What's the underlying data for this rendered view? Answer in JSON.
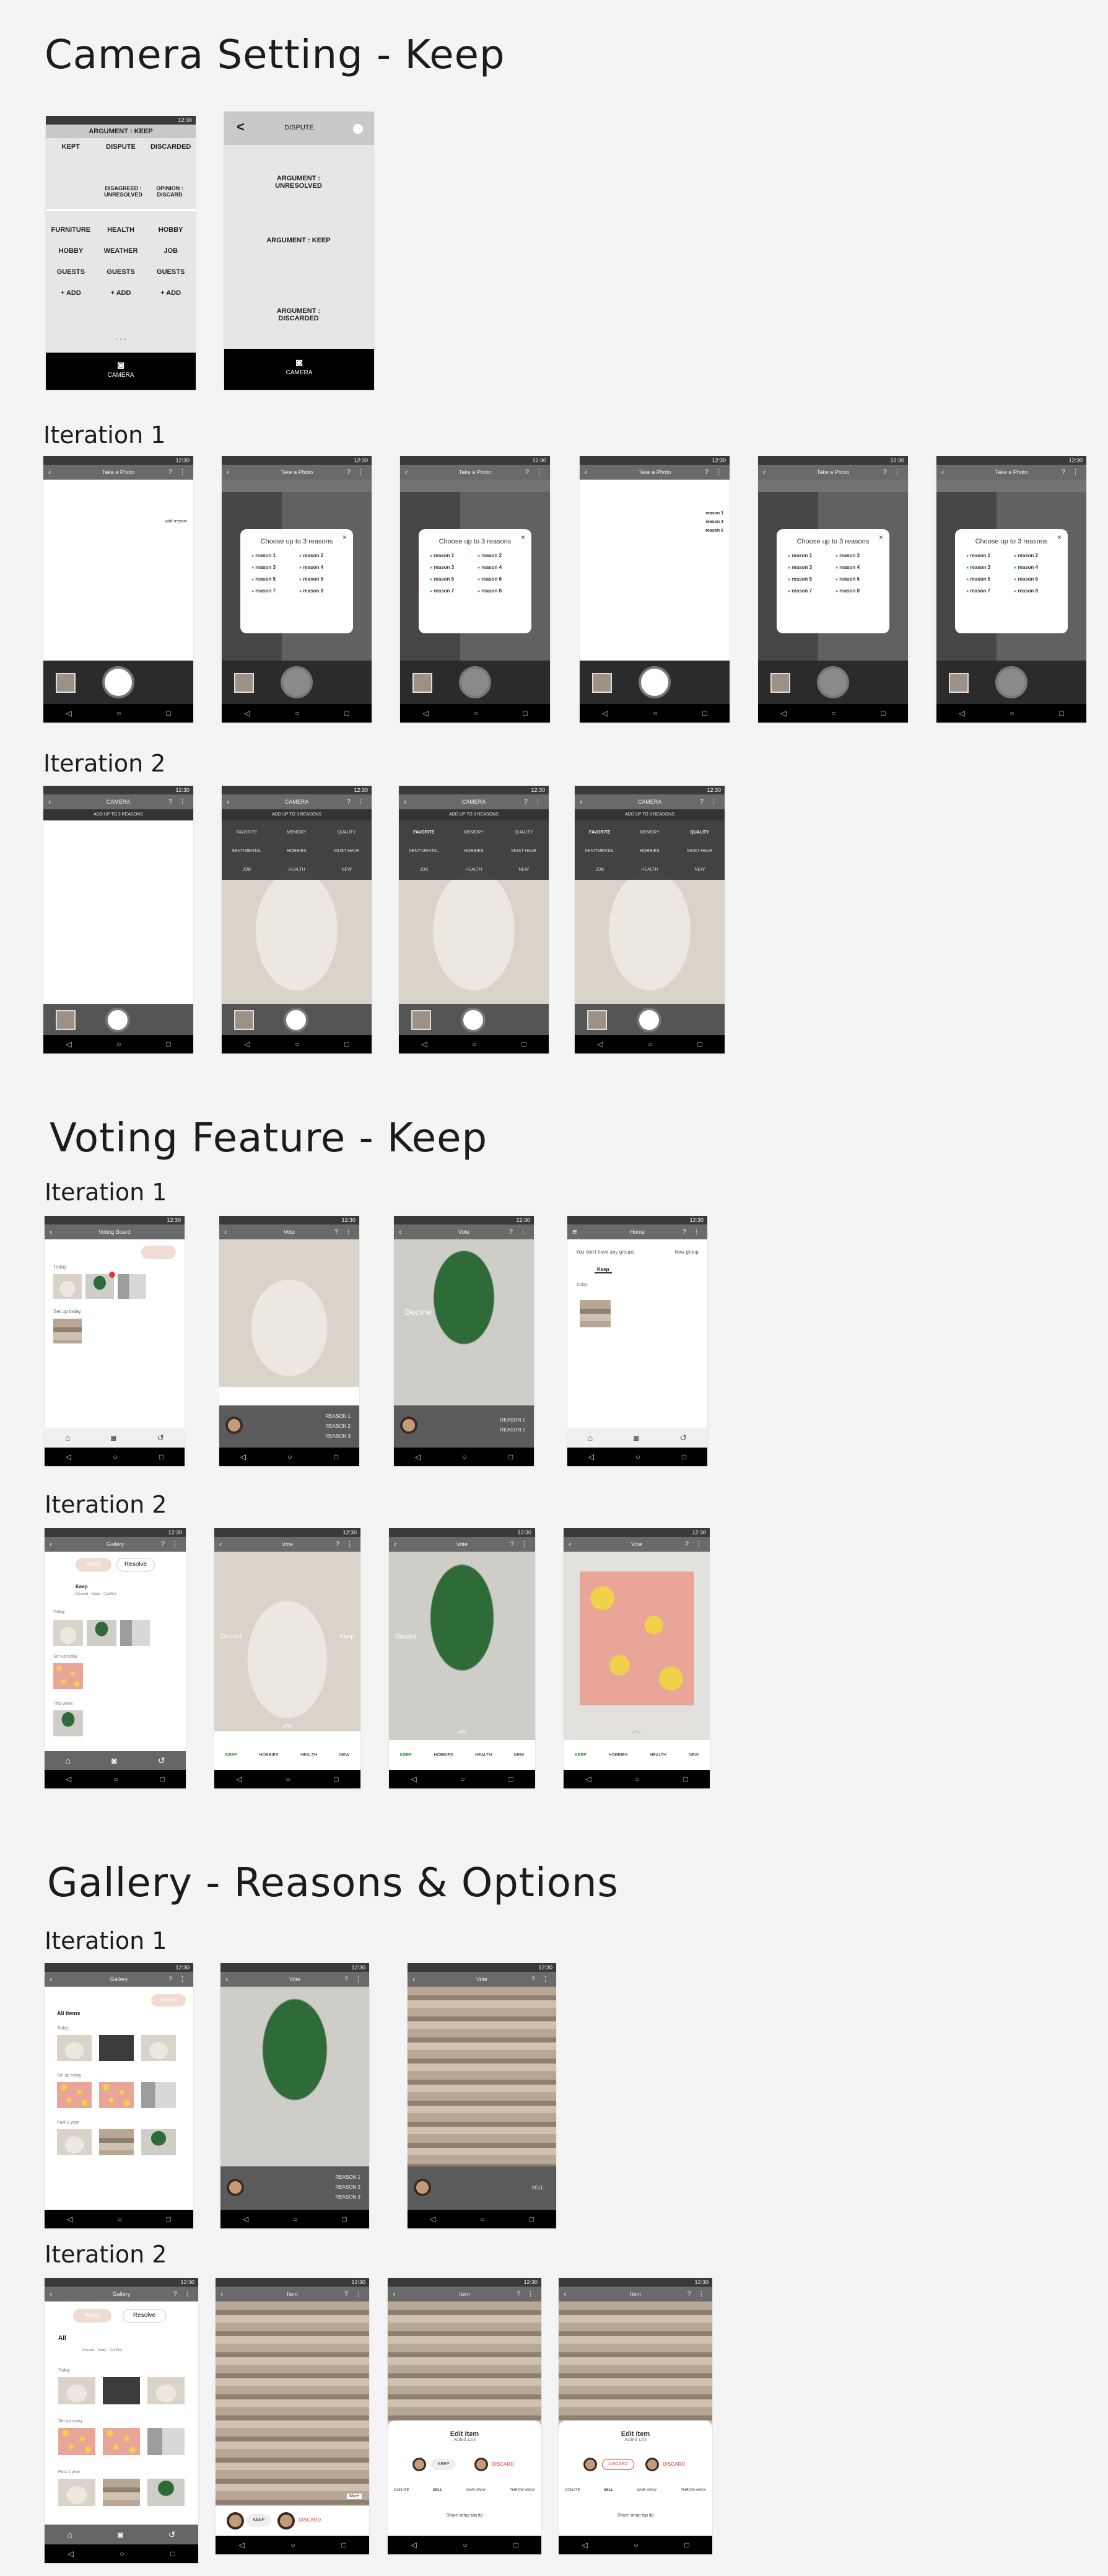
{
  "sections": {
    "camera_setting": "Camera Setting - Keep",
    "voting_feature": "Voting Feature - Keep",
    "gallery": "Gallery - Reasons & Options"
  },
  "iterations": {
    "one": "Iteration 1",
    "two": "Iteration 2"
  },
  "status_time": "12:30",
  "nav_glyphs": {
    "back": "◁",
    "home": "○",
    "recent": "□"
  },
  "wire": {
    "header": "ARGUMENT : KEEP",
    "tabs": [
      "KEPT",
      "DISPUTE",
      "DISCARDED"
    ],
    "sub": [
      "DISAGREED : UNRESOLVED",
      "OPINION : DISCARD"
    ],
    "cats": [
      "FURNITURE",
      "HEALTH",
      "HOBBY",
      "HOBBY",
      "WEATHER",
      "JOB",
      "GUESTS",
      "GUESTS",
      "GUESTS",
      "+ ADD",
      "+ ADD",
      "+ ADD"
    ],
    "more": ". . .",
    "camera": "CAMERA",
    "dispute_title": "DISPUTE",
    "back": "<",
    "dispute_items": [
      "ARGUMENT : UNRESOLVED",
      "ARGUMENT : KEEP",
      "ARGUMENT : DISCARDED"
    ]
  },
  "cam": {
    "title": "Take a Photo",
    "dialog_title": "Choose up to 3 reasons",
    "reasons": [
      "reason 1",
      "reason 2",
      "reason 3",
      "reason 4",
      "reason 5",
      "reason 6",
      "reason 7",
      "reason 8"
    ],
    "side_tag": "add reason",
    "close": "×",
    "help_icons": "? ⋮"
  },
  "cam2": {
    "title": "CAMERA",
    "banner": "ADD UP TO 3 REASONS",
    "tags": [
      "FAVORITE",
      "MEMORY",
      "QUALITY",
      "SENTIMENTAL",
      "HOBBIES",
      "MUST HAVE",
      "JOB",
      "HEALTH",
      "NEW"
    ]
  },
  "vote1": {
    "title_a": "Voting Board",
    "title_b": "Vote",
    "title_c": "Vote",
    "title_d": "Home",
    "label_a": "Today",
    "label_b": "Set up today",
    "plant_label": "Decline",
    "reasons": [
      "REASON 1",
      "REASON 2",
      "REASON 3"
    ],
    "groups_msg": "You don't have any groups",
    "new_group": "New group",
    "tab": "Keep",
    "row_label": "Today"
  },
  "vote2": {
    "title_a": "Gallery",
    "title_b": "Vote",
    "pill_a": "Keep",
    "pill_b": "Resolve",
    "tab": "Keep",
    "tabs_mini": [
      "Discard",
      "Keep",
      "Conflict"
    ],
    "sections": [
      "Today",
      "Set up today",
      "This week"
    ],
    "discard": "Discard",
    "keep": "Keep",
    "bottom_cats": [
      "KEEP",
      "HOBBIES",
      "HEALTH",
      "NEW"
    ]
  },
  "gal1": {
    "title": "Gallery",
    "pill": "Resolve",
    "all_items": "All Items",
    "sections": [
      "Today",
      "Set up today",
      "Past 1 year"
    ],
    "vote_a": [
      "REASON 1",
      "REASON 2",
      "REASON 3"
    ],
    "sell": "SELL"
  },
  "gal2": {
    "title_a": "Gallery",
    "title_b": "Item",
    "pill_a": "Keep",
    "pill_b": "Resolve",
    "all": "All",
    "tabs_mini": [
      "Discard",
      "Keep",
      "Conflict"
    ],
    "sections": [
      "Today",
      "Set up today",
      "Past 1 year"
    ],
    "edit_title": "Edit Item",
    "edit_sub": "Added 12/3",
    "discard": "DISCARD",
    "keep": "KEEP",
    "options": [
      "DONATE",
      "SELL",
      "GIVE AWAY",
      "THROW AWAY"
    ],
    "share": "Share setup tap tip",
    "more": "More"
  }
}
